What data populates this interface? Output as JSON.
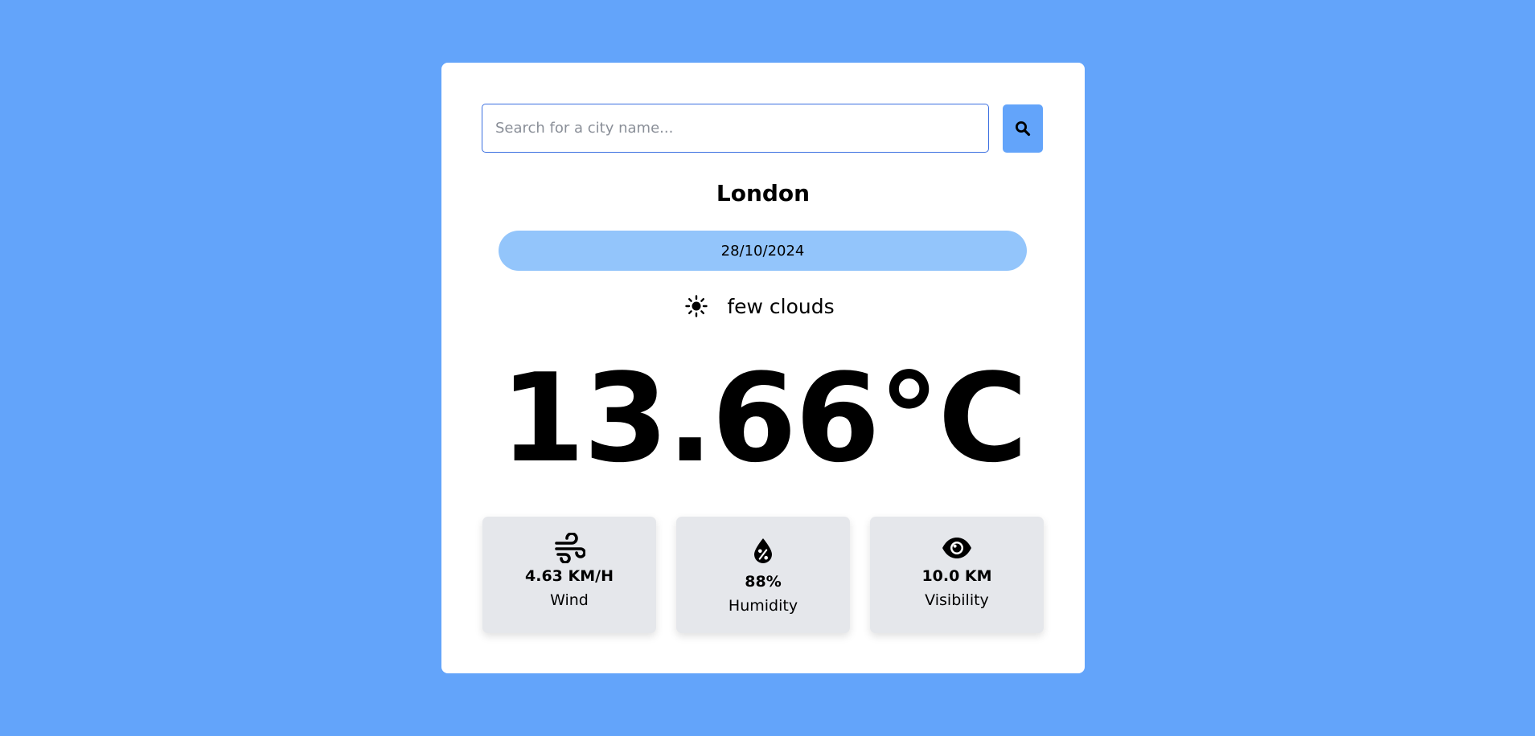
{
  "search": {
    "placeholder": "Search for a city name...",
    "value": ""
  },
  "weather": {
    "city": "London",
    "date": "28/10/2024",
    "condition": "few clouds",
    "condition_icon": "sun-icon",
    "temperature": "13.66°C"
  },
  "stats": [
    {
      "icon": "wind-icon",
      "value": "4.63 KM/H",
      "label": "Wind"
    },
    {
      "icon": "humidity-icon",
      "value": "88%",
      "label": "Humidity"
    },
    {
      "icon": "eye-icon",
      "value": "10.0 KM",
      "label": "Visibility"
    }
  ],
  "colors": {
    "background": "#63a4fa",
    "card": "#ffffff",
    "accent": "#63a4fa",
    "date_pill": "#93c5fb",
    "stat_box": "#e5e7eb",
    "input_border": "#3b6fe0"
  }
}
